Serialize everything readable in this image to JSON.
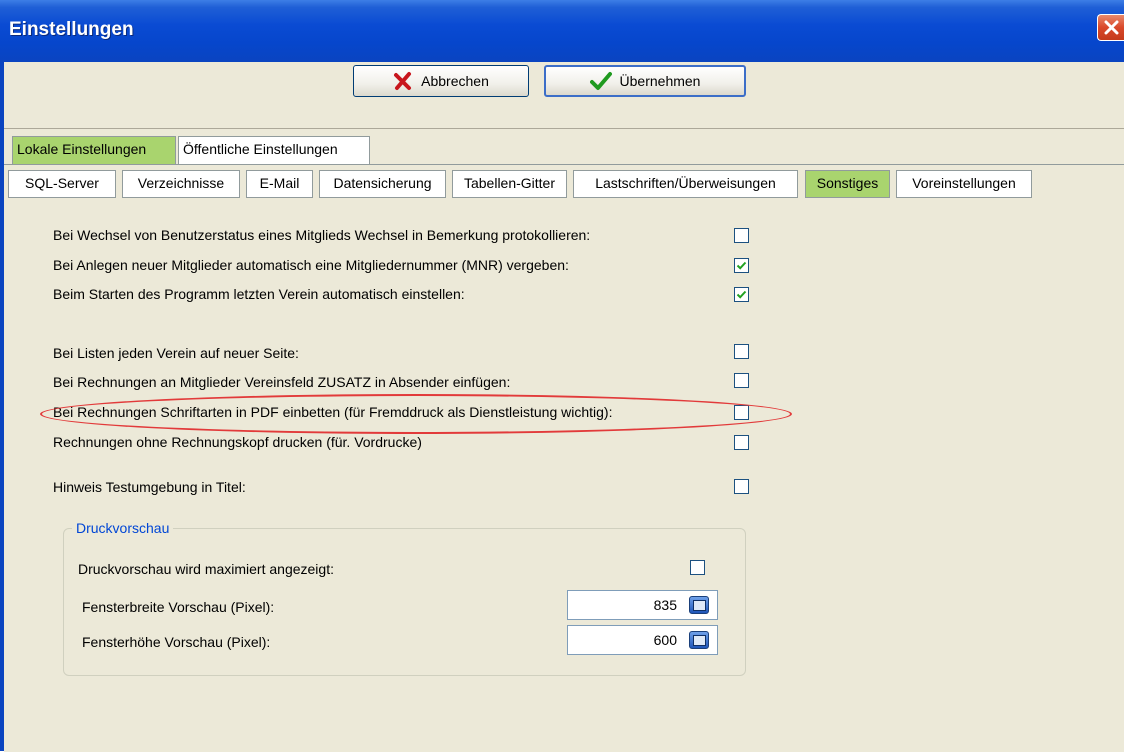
{
  "window": {
    "title": "Einstellungen"
  },
  "toolbar": {
    "cancel_label": "Abbrechen",
    "ok_label": "Übernehmen"
  },
  "main_tabs": [
    {
      "label": "Lokale Einstellungen",
      "active": true
    },
    {
      "label": "Öffentliche Einstellungen",
      "active": false
    }
  ],
  "sub_tabs": [
    {
      "label": "SQL-Server",
      "active": false
    },
    {
      "label": "Verzeichnisse",
      "active": false
    },
    {
      "label": "E-Mail",
      "active": false
    },
    {
      "label": "Datensicherung",
      "active": false
    },
    {
      "label": "Tabellen-Gitter",
      "active": false
    },
    {
      "label": "Lastschriften/Überweisungen",
      "active": false
    },
    {
      "label": "Sonstiges",
      "active": true
    },
    {
      "label": "Voreinstellungen",
      "active": false
    }
  ],
  "options": [
    {
      "label": "Bei Wechsel von Benutzerstatus eines Mitglieds Wechsel in Bemerkung protokollieren:",
      "checked": false
    },
    {
      "label": "Bei Anlegen neuer Mitglieder automatisch eine Mitgliedernummer (MNR) vergeben:",
      "checked": true
    },
    {
      "label": "Beim Starten des Programm letzten Verein automatisch einstellen:",
      "checked": true
    },
    {
      "label": "Bei Listen jeden Verein auf neuer Seite:",
      "checked": false
    },
    {
      "label": "Bei Rechnungen an Mitglieder Vereinsfeld ZUSATZ in Absender einfügen:",
      "checked": false
    },
    {
      "label": "Bei Rechnungen Schriftarten in PDF einbetten (für Fremddruck als Dienstleistung wichtig):",
      "checked": false,
      "highlighted": true
    },
    {
      "label": "Rechnungen ohne Rechnungskopf drucken (für. Vordrucke)",
      "checked": false
    },
    {
      "label": "Hinweis Testumgebung in Titel:",
      "checked": false
    }
  ],
  "preview_group": {
    "title": "Druckvorschau",
    "maximized_label": "Druckvorschau wird maximiert angezeigt:",
    "maximized_checked": false,
    "width_label": "Fensterbreite Vorschau (Pixel):",
    "width_value": "835",
    "height_label": "Fensterhöhe Vorschau (Pixel):",
    "height_value": "600"
  },
  "colors": {
    "active_tab": "#a9d46e",
    "titlebar": "#0a4bd3",
    "highlight_ellipse": "#e23a3a",
    "group_title": "#0046d5"
  },
  "icons": {
    "cancel": "red-x-icon",
    "ok": "green-check-icon",
    "close": "close-icon",
    "calculator": "calculator-icon"
  }
}
